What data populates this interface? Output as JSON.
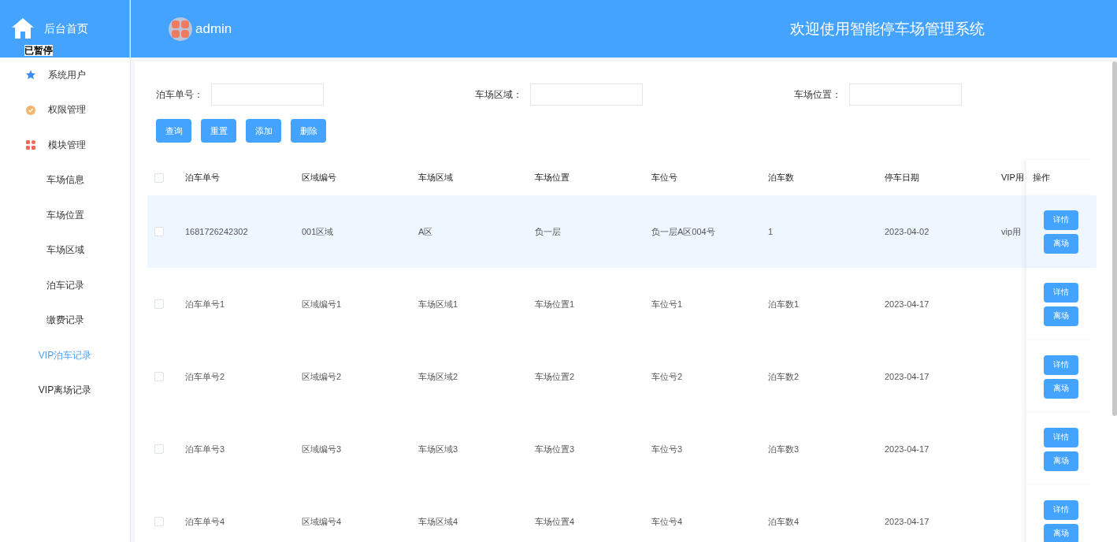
{
  "sidebar": {
    "home_label": "后台首页",
    "paused_label": "已暂停",
    "items": [
      {
        "label": "系统用户",
        "kind": "star",
        "selected": false
      },
      {
        "label": "权限管理",
        "kind": "badge",
        "selected": false
      },
      {
        "label": "模块管理",
        "kind": "grid",
        "selected": false
      },
      {
        "label": "车场信息",
        "kind": "sub",
        "selected": false
      },
      {
        "label": "车场位置",
        "kind": "sub",
        "selected": false
      },
      {
        "label": "车场区域",
        "kind": "sub",
        "selected": false
      },
      {
        "label": "泊车记录",
        "kind": "sub",
        "selected": false
      },
      {
        "label": "缴费记录",
        "kind": "sub",
        "selected": false
      },
      {
        "label": "VIP泊车记录",
        "kind": "sub",
        "selected": true
      },
      {
        "label": "VIP离场记录",
        "kind": "sub",
        "selected": false
      }
    ]
  },
  "header": {
    "user": "admin",
    "title": "欢迎使用智能停车场管理系统"
  },
  "search": {
    "fields": [
      {
        "label": "泊车单号："
      },
      {
        "label": "车场区域："
      },
      {
        "label": "车场位置："
      }
    ],
    "buttons": [
      "查询",
      "重置",
      "添加",
      "删除"
    ]
  },
  "table": {
    "select_all_checked": false,
    "columns": [
      "泊车单号",
      "区域编号",
      "车场区域",
      "车场位置",
      "车位号",
      "泊车数",
      "停车日期",
      "VIP用"
    ],
    "action_column": "操作",
    "rows": [
      {
        "checked": false,
        "hovered": true,
        "cells": [
          "1681726242302",
          "001区域",
          "A区",
          "负一层",
          "负一层A区004号",
          "1",
          "2023-04-02",
          "vip用"
        ],
        "actions": [
          "详情",
          "离场"
        ]
      },
      {
        "checked": false,
        "hovered": false,
        "cells": [
          "泊车单号1",
          "区域编号1",
          "车场区域1",
          "车场位置1",
          "车位号1",
          "泊车数1",
          "2023-04-17"
        ],
        "actions": [
          "详情",
          "离场"
        ]
      },
      {
        "checked": false,
        "hovered": false,
        "cells": [
          "泊车单号2",
          "区域编号2",
          "车场区域2",
          "车场位置2",
          "车位号2",
          "泊车数2",
          "2023-04-17"
        ],
        "actions": [
          "详情",
          "离场"
        ]
      },
      {
        "checked": false,
        "hovered": false,
        "cells": [
          "泊车单号3",
          "区域编号3",
          "车场区域3",
          "车场位置3",
          "车位号3",
          "泊车数3",
          "2023-04-17"
        ],
        "actions": [
          "详情",
          "离场"
        ]
      },
      {
        "checked": false,
        "hovered": false,
        "cells": [
          "泊车单号4",
          "区域编号4",
          "车场区域4",
          "车场位置4",
          "车位号4",
          "泊车数4",
          "2023-04-17"
        ],
        "actions": [
          "详情",
          "离场"
        ]
      }
    ]
  }
}
